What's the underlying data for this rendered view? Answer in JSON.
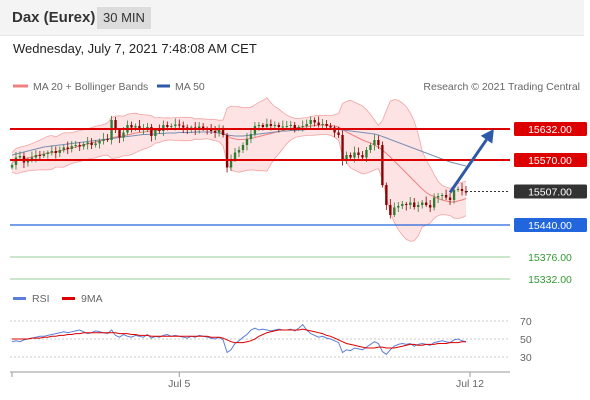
{
  "header": {
    "instrument": "Dax (Eurex)",
    "timeframe": "30 MIN",
    "datetime": "Wednesday, July 7, 2021 7:48:08 AM CET"
  },
  "legend": {
    "bollinger": "MA 20 + Bollinger Bands",
    "ma50": "MA 50",
    "credit": "Research © 2021 Trading Central",
    "rsi": "RSI",
    "rsi_ma": "9MA"
  },
  "colors": {
    "resistance": "#dd0000",
    "support": "#2266dd",
    "target": "#339933",
    "current": "#333333",
    "up_candle": "#2e7d32",
    "down_candle": "#8b0000",
    "bollinger_fill": "#fde3e3",
    "bollinger_line": "#f3a3a3",
    "ma50": "#7b8fb5",
    "arrow": "#2d5aa8",
    "rsi": "#5b7fd6",
    "rsi_ma": "#dd0000"
  },
  "chart_data": {
    "type": "candlestick",
    "price_range": [
      15310,
      15680
    ],
    "levels": [
      {
        "value": 15632.0,
        "label": "15632.00",
        "kind": "resistance"
      },
      {
        "value": 15570.0,
        "label": "15570.00",
        "kind": "resistance"
      },
      {
        "value": 15507.0,
        "label": "15507.00",
        "kind": "current"
      },
      {
        "value": 15440.0,
        "label": "15440.00",
        "kind": "support"
      },
      {
        "value": 15376.0,
        "label": "15376.00",
        "kind": "target"
      },
      {
        "value": 15332.0,
        "label": "15332.00",
        "kind": "target"
      }
    ],
    "x_labels": [
      {
        "index": 42,
        "label": "Jul 5"
      },
      {
        "index": 115,
        "label": "Jul 12"
      }
    ],
    "arrow": {
      "from_index": 110,
      "from_value": 15505,
      "to_index": 121,
      "to_value": 15632
    },
    "closes": [
      15560,
      15575,
      15578,
      15565,
      15570,
      15575,
      15580,
      15578,
      15582,
      15585,
      15588,
      15584,
      15590,
      15595,
      15592,
      15598,
      15600,
      15597,
      15602,
      15605,
      15600,
      15603,
      15608,
      15612,
      15610,
      15650,
      15630,
      15615,
      15625,
      15640,
      15635,
      15638,
      15630,
      15632,
      15636,
      15618,
      15630,
      15628,
      15640,
      15636,
      15638,
      15641,
      15639,
      15635,
      15630,
      15635,
      15630,
      15637,
      15632,
      15630,
      15628,
      15625,
      15633,
      15620,
      15555,
      15570,
      15585,
      15590,
      15600,
      15612,
      15622,
      15638,
      15640,
      15636,
      15642,
      15638,
      15640,
      15636,
      15637,
      15638,
      15640,
      15632,
      15636,
      15638,
      15642,
      15650,
      15645,
      15640,
      15642,
      15638,
      15635,
      15625,
      15620,
      15570,
      15580,
      15575,
      15585,
      15580,
      15575,
      15590,
      15600,
      15610,
      15600,
      15520,
      15480,
      15460,
      15475,
      15478,
      15482,
      15480,
      15485,
      15476,
      15480,
      15485,
      15480,
      15475,
      15495,
      15498,
      15500,
      15495,
      15490,
      15510,
      15512,
      15508,
      15505
    ],
    "ma20": [
      15565,
      15568,
      15570,
      15572,
      15574,
      15576,
      15578,
      15580,
      15582,
      15584,
      15585,
      15586,
      15588,
      15590,
      15592,
      15594,
      15596,
      15598,
      15600,
      15602,
      15604,
      15606,
      15608,
      15610,
      15612,
      15614,
      15616,
      15617,
      15618,
      15620,
      15622,
      15624,
      15625,
      15626,
      15627,
      15628,
      15629,
      15630,
      15631,
      15632,
      15632,
      15632,
      15632,
      15632,
      15632,
      15632,
      15632,
      15632,
      15632,
      15632,
      15631,
      15630,
      15628,
      15624,
      15619,
      15614,
      15612,
      15611,
      15611,
      15612,
      15613,
      15615,
      15617,
      15619,
      15621,
      15623,
      15625,
      15627,
      15629,
      15631,
      15633,
      15634,
      15635,
      15636,
      15637,
      15638,
      15639,
      15640,
      15640,
      15640,
      15639,
      15638,
      15636,
      15631,
      15626,
      15622,
      15618,
      15614,
      15610,
      15607,
      15604,
      15600,
      15596,
      15590,
      15583,
      15576,
      15568,
      15560,
      15552,
      15544,
      15536,
      15528,
      15520,
      15512,
      15505,
      15500,
      15497,
      15493,
      15490,
      15488,
      15486,
      15486,
      15488,
      15490,
      15493
    ],
    "ma50": [
      15580,
      15582,
      15584,
      15586,
      15588,
      15590,
      15592,
      15594,
      15596,
      15597,
      15598,
      15599,
      15600,
      15601,
      15602,
      15603,
      15604,
      15605,
      15606,
      15607,
      15608,
      15609,
      15610,
      15611,
      15612,
      15613,
      15614,
      15615,
      15616,
      15617,
      15618,
      15619,
      15620,
      15621,
      15621,
      15622,
      15622,
      15623,
      15623,
      15624,
      15624,
      15624,
      15625,
      15625,
      15625,
      15625,
      15626,
      15626,
      15626,
      15626,
      15626,
      15625,
      15624,
      15622,
      15620,
      15619,
      15618,
      15618,
      15618,
      15619,
      15620,
      15621,
      15622,
      15623,
      15624,
      15625,
      15626,
      15627,
      15628,
      15628,
      15629,
      15629,
      15630,
      15630,
      15631,
      15631,
      15632,
      15632,
      15632,
      15632,
      15632,
      15631,
      15631,
      15630,
      15629,
      15628,
      15627,
      15626,
      15625,
      15624,
      15623,
      15622,
      15620,
      15617,
      15614,
      15611,
      15608,
      15605,
      15602,
      15599,
      15596,
      15593,
      15590,
      15587,
      15584,
      15581,
      15578,
      15575,
      15572,
      15569,
      15566,
      15564,
      15562,
      15560,
      15558
    ],
    "rsi": {
      "levels": [
        70,
        50,
        30
      ],
      "range": [
        20,
        80
      ],
      "rsi": [
        47,
        48,
        47,
        49,
        50,
        51,
        52,
        53,
        53,
        54,
        55,
        56,
        57,
        58,
        57,
        58,
        59,
        60,
        58,
        56,
        57,
        59,
        58,
        57,
        56,
        60,
        54,
        52,
        55,
        53,
        52,
        54,
        53,
        52,
        55,
        51,
        53,
        52,
        54,
        55,
        53,
        54,
        53,
        52,
        51,
        53,
        52,
        54,
        53,
        52,
        51,
        50,
        52,
        49,
        35,
        38,
        45,
        48,
        52,
        55,
        60,
        62,
        60,
        61,
        60,
        59,
        60,
        61,
        60,
        60,
        61,
        59,
        62,
        66,
        60,
        56,
        54,
        52,
        53,
        51,
        50,
        48,
        46,
        35,
        38,
        37,
        40,
        39,
        38,
        41,
        44,
        47,
        45,
        36,
        33,
        38,
        42,
        44,
        45,
        44,
        45,
        42,
        44,
        45,
        44,
        43,
        46,
        47,
        48,
        47,
        46,
        49,
        50,
        48,
        47
      ],
      "ma9": [
        50,
        50,
        50,
        50,
        50,
        51,
        51,
        51,
        52,
        52,
        53,
        53,
        54,
        54,
        55,
        55,
        56,
        56,
        57,
        57,
        57,
        57,
        57,
        57,
        57,
        57,
        57,
        56,
        56,
        56,
        55,
        55,
        54,
        54,
        54,
        53,
        53,
        53,
        53,
        53,
        53,
        53,
        53,
        53,
        53,
        53,
        53,
        53,
        53,
        53,
        52,
        52,
        52,
        51,
        49,
        47,
        46,
        46,
        46,
        47,
        48,
        50,
        53,
        55,
        57,
        58,
        59,
        60,
        60,
        60,
        60,
        60,
        60,
        61,
        60,
        59,
        58,
        57,
        56,
        54,
        53,
        51,
        49,
        47,
        45,
        44,
        43,
        42,
        41,
        40,
        40,
        40,
        41,
        41,
        40,
        40,
        40,
        41,
        42,
        43,
        44,
        44,
        43,
        43,
        44,
        44,
        44,
        45,
        45,
        45,
        46,
        46,
        46,
        47,
        47
      ]
    }
  }
}
